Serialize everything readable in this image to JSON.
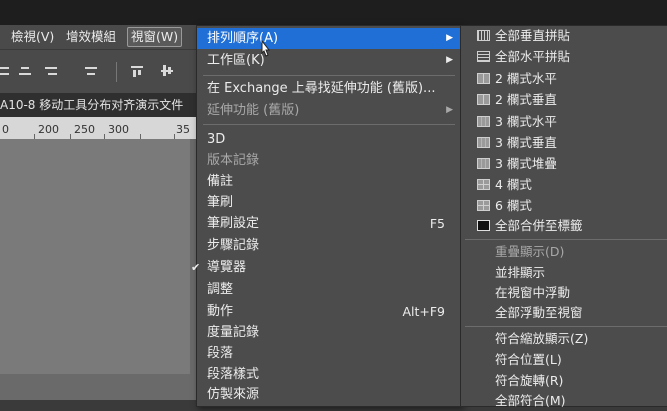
{
  "menubar": {
    "items": [
      {
        "label": "檢視(V)"
      },
      {
        "label": "增效模組"
      },
      {
        "label": "視窗(W)"
      }
    ]
  },
  "document": {
    "tab_title": "A10-8 移动工具分布对齐演示文件"
  },
  "ruler": {
    "labels": [
      "0",
      "200",
      "250",
      "300",
      "35"
    ]
  },
  "window_menu": {
    "items": [
      {
        "label": "排列順序(A)",
        "has_submenu": true,
        "highlighted": true
      },
      {
        "label": "工作區(K)",
        "has_submenu": true
      },
      {
        "label": "在 Exchange 上尋找延伸功能 (舊版)..."
      },
      {
        "label": "延伸功能 (舊版)",
        "has_submenu": true,
        "dim": true
      },
      {
        "label": "3D"
      },
      {
        "label": "版本記錄",
        "dim": true
      },
      {
        "label": "備註"
      },
      {
        "label": "筆刷"
      },
      {
        "label": "筆刷設定",
        "shortcut": "F5"
      },
      {
        "label": "步驟記錄"
      },
      {
        "label": "導覽器",
        "checked": true
      },
      {
        "label": "調整"
      },
      {
        "label": "動作",
        "shortcut": "Alt+F9"
      },
      {
        "label": "度量記錄"
      },
      {
        "label": "段落"
      },
      {
        "label": "段落樣式"
      },
      {
        "label": "仿製來源"
      }
    ]
  },
  "arrange_submenu": {
    "items": [
      {
        "label": "全部垂直拼貼",
        "icon": "tile-vertical-icon"
      },
      {
        "label": "全部水平拼貼",
        "icon": "tile-horizontal-icon"
      },
      {
        "label": "2 欄式水平",
        "icon": "two-up-horizontal-icon"
      },
      {
        "label": "2 欄式垂直",
        "icon": "two-up-vertical-icon"
      },
      {
        "label": "3 欄式水平",
        "icon": "three-up-horizontal-icon"
      },
      {
        "label": "3 欄式垂直",
        "icon": "three-up-vertical-icon"
      },
      {
        "label": "3 欄式堆疊",
        "icon": "three-up-stacked-icon"
      },
      {
        "label": "4 欄式",
        "icon": "four-up-icon"
      },
      {
        "label": "6 欄式",
        "icon": "six-up-icon"
      },
      {
        "label": "全部合併至標籤",
        "icon": "consolidate-tabs-icon"
      },
      {
        "label": "重疊顯示(D)",
        "dim": true
      },
      {
        "label": "並排顯示"
      },
      {
        "label": "在視窗中浮動"
      },
      {
        "label": "全部浮動至視窗"
      },
      {
        "label": "符合縮放顯示(Z)"
      },
      {
        "label": "符合位置(L)"
      },
      {
        "label": "符合旋轉(R)"
      },
      {
        "label": "全部符合(M)"
      }
    ]
  },
  "colors": {
    "highlight": "#1f6fd6",
    "menu_bg": "#4c4c4c"
  }
}
